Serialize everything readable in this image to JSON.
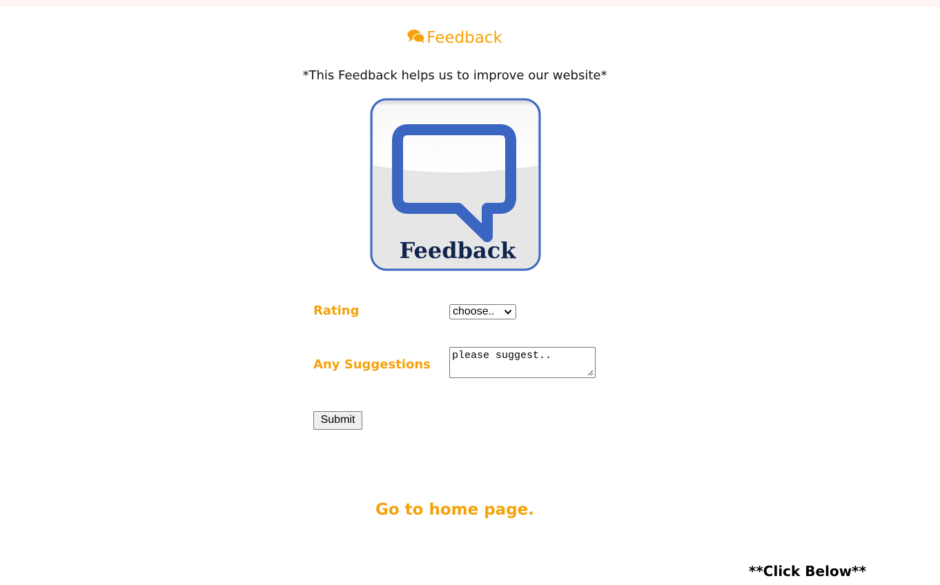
{
  "header": {
    "title": "Feedback",
    "title_icon": "comments-icon",
    "subtitle": "*This Feedback helps us to improve our website*"
  },
  "logo": {
    "text": "Feedback",
    "icon": "speech-bubble-icon",
    "colors": {
      "bubble": "#3a66c1",
      "text": "#10244d"
    }
  },
  "form": {
    "rating_label": "Rating",
    "rating_selected": "choose..",
    "suggestions_label": "Any Suggestions",
    "suggestions_value": "please suggest..",
    "submit_label": "Submit"
  },
  "footer": {
    "home_link": "Go to home page.",
    "click_below": "**Click Below**"
  },
  "colors": {
    "accent": "#f5a20a"
  }
}
